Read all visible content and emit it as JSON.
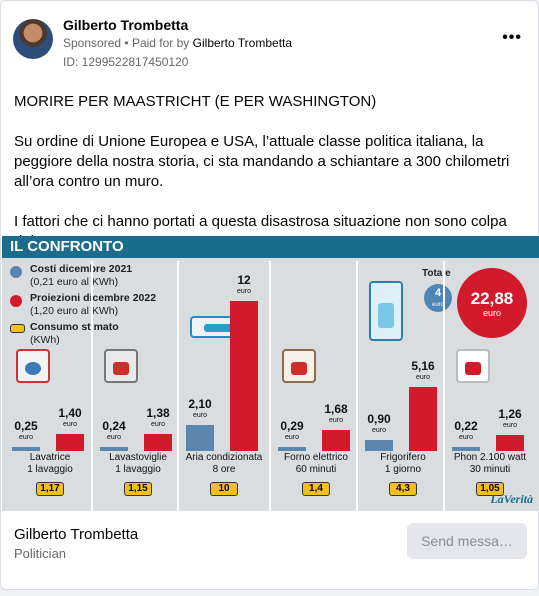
{
  "post": {
    "author": "Gilberto Trombetta",
    "sponsored": "Sponsored",
    "paid_for_prefix": "Paid for by",
    "paid_for_name": "Gilberto Trombetta",
    "ad_id": "ID: 1299522817450120",
    "more_label": "•••",
    "paragraphs": [
      "MORIRE PER MAASTRICHT (E PER WASHINGTON)",
      "Su ordine di Unione Europea e USA, l’attuale classe politica italiana, la peggiore della nostra storia, ci sta mandando a schiantare a 300 chilometri all’ora contro un muro.",
      "I fattori che ci hanno portati a questa disastrosa situazione non sono colpa del…"
    ]
  },
  "infographic": {
    "title": "IL CONFRONTO",
    "legend": {
      "blue_title": "Costi dicembre 2021",
      "blue_sub": "(0,21 euro al KWh)",
      "red_title": "Proiezioni dicembre 2022",
      "red_sub": "(1,20 euro al KWh)",
      "kwh_title": "Consumo stimato",
      "kwh_sub": "(KWh)"
    },
    "total": {
      "label": "Totale",
      "blue_value": "4",
      "blue_unit": "euro",
      "red_value": "22,88",
      "red_unit": "euro"
    },
    "unit": "euro",
    "brand": "LaVerità",
    "colors": {
      "blue": "#5b86ad",
      "red": "#d11b2c",
      "header": "#1c6c8e",
      "kwh": "#f2c01a"
    },
    "items": [
      {
        "name": "Lavatrice",
        "detail": "1 lavaggio",
        "blue_label": "0,25",
        "red_label": "1,40",
        "blue": 0.25,
        "red": 1.4,
        "kwh": "1,17"
      },
      {
        "name": "Lavastoviglie",
        "detail": "1 lavaggio",
        "blue_label": "0,24",
        "red_label": "1,38",
        "blue": 0.24,
        "red": 1.38,
        "kwh": "1,15"
      },
      {
        "name": "Aria condizionata",
        "detail": "8 ore",
        "blue_label": "2,10",
        "red_label": "12",
        "blue": 2.1,
        "red": 12,
        "kwh": "10"
      },
      {
        "name": "Forno elettrico",
        "detail": "60 minuti",
        "blue_label": "0,29",
        "red_label": "1,68",
        "blue": 0.29,
        "red": 1.68,
        "kwh": "1,4"
      },
      {
        "name": "Frigorifero",
        "detail": "1 giorno",
        "blue_label": "0,90",
        "red_label": "5,16",
        "blue": 0.9,
        "red": 5.16,
        "kwh": "4,3"
      },
      {
        "name": "Phon 2.100 watt",
        "detail": "30 minuti",
        "blue_label": "0,22",
        "red_label": "1,26",
        "blue": 0.22,
        "red": 1.26,
        "kwh": "1,05"
      }
    ]
  },
  "footer": {
    "name": "Gilberto Trombetta",
    "role": "Politician",
    "send_button": "Send messa…"
  }
}
